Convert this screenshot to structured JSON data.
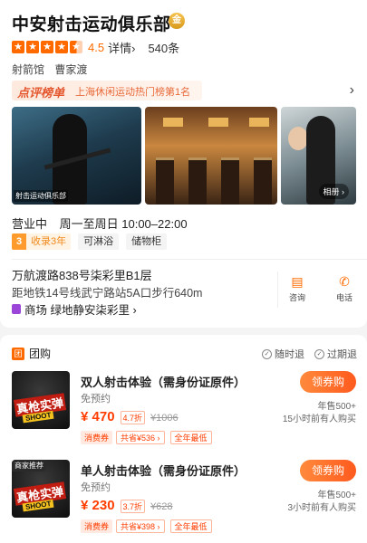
{
  "shop": {
    "name": "中安射击运动俱乐部",
    "badge": "金",
    "rating": 4.5,
    "rating_text": "4.5",
    "detail_label": "详情",
    "review_count": "540条",
    "categories": [
      "射箭馆",
      "曹家渡"
    ]
  },
  "ranking": {
    "label": "点评榜单",
    "text": "上海休闲运动热门榜第1名"
  },
  "gallery": {
    "photo1_overlay": "射击运动俱乐部",
    "album_button": "相册 ›"
  },
  "hours": {
    "state": "营业中",
    "schedule": "周一至周日 10:00–22:00"
  },
  "chips": {
    "years_num": "3",
    "years_label": "收录3年",
    "amenities": [
      "可淋浴",
      "储物柜"
    ]
  },
  "location": {
    "address": "万航渡路838号柒彩里B1层",
    "subway": "距地铁14号线武宁路站5A口步行640m",
    "mall": "商场  绿地静安柒彩里 ›"
  },
  "actions": {
    "consult": "咨询",
    "call": "电话"
  },
  "deals": {
    "title": "团购",
    "refund_any": "随时退",
    "refund_expire": "过期退",
    "items": [
      {
        "thumb_tag": "",
        "thumb_text1": "真枪实弹",
        "thumb_text2": "SHOOT",
        "name": "双人射击体验（需身份证原件）",
        "reservation": "免预约",
        "price": "¥ 470",
        "discount": "4.7折",
        "original": "¥1006",
        "coupon_a": "消费券",
        "coupon_b": "共省¥536 ›",
        "coupon_c": "全年最低",
        "buy": "领券购",
        "sold": "年售500+",
        "recent": "15小时前有人购买"
      },
      {
        "thumb_tag": "商家推荐",
        "thumb_text1": "真枪实弹",
        "thumb_text2": "SHOOT",
        "name": "单人射击体验（需身份证原件）",
        "reservation": "免预约",
        "price": "¥ 230",
        "discount": "3.7折",
        "original": "¥628",
        "coupon_a": "消费券",
        "coupon_b": "共省¥398 ›",
        "coupon_c": "全年最低",
        "buy": "领券购",
        "sold": "年售500+",
        "recent": "3小时前有人购买"
      }
    ]
  },
  "colors": {
    "accent": "#ff6a00",
    "price": "#ff3d00",
    "rank_text": "#e4572e"
  }
}
